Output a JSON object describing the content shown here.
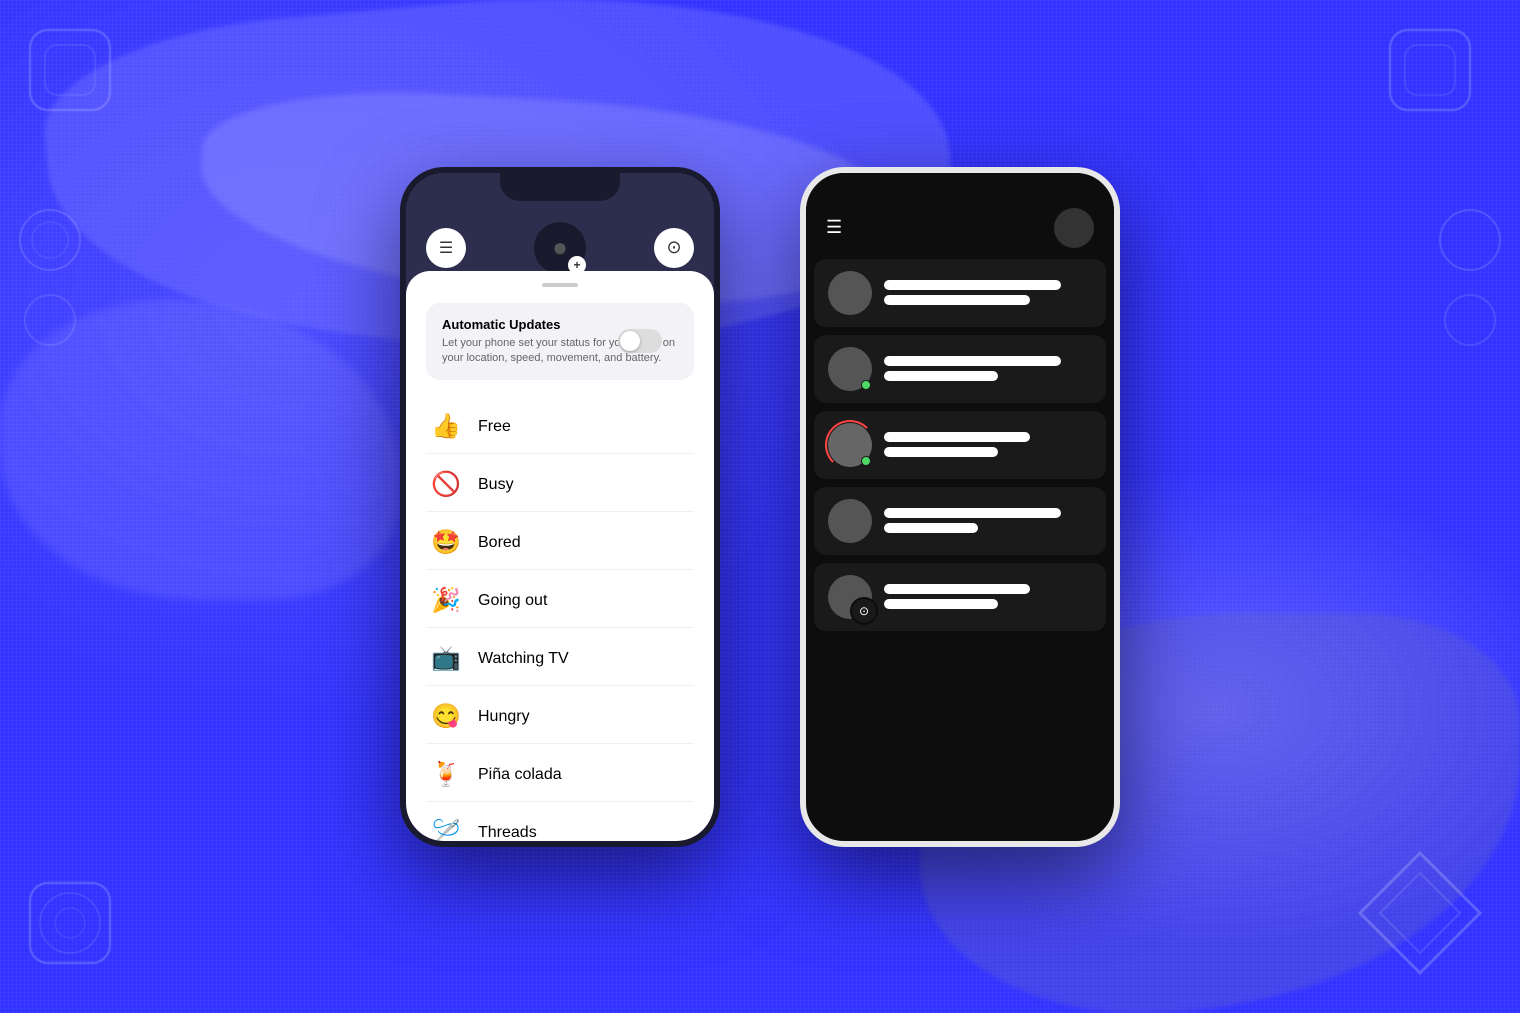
{
  "background": {
    "color": "#3333ff"
  },
  "phone_left": {
    "header": {
      "menu_icon": "☰",
      "camera_icon": "⊙"
    },
    "bottom_sheet": {
      "auto_updates": {
        "title": "Automatic Updates",
        "description": "Let your phone set your status for you based on your location, speed, movement, and battery.",
        "toggle_state": false
      },
      "status_items": [
        {
          "emoji": "👍",
          "label": "Free"
        },
        {
          "emoji": "🚫",
          "label": "Busy"
        },
        {
          "emoji": "🤩",
          "label": "Bored"
        },
        {
          "emoji": "🎉",
          "label": "Going out"
        },
        {
          "emoji": "📺",
          "label": "Watching TV"
        },
        {
          "emoji": "😋",
          "label": "Hungry"
        },
        {
          "emoji": "🍹",
          "label": "Piña colada"
        },
        {
          "emoji": "🪡",
          "label": "Threads"
        }
      ]
    }
  },
  "phone_right": {
    "contacts": [
      {
        "has_online": false,
        "has_ring": false,
        "has_camera": false,
        "lines": [
          "long",
          "medium"
        ]
      },
      {
        "has_online": true,
        "has_ring": false,
        "has_camera": false,
        "lines": [
          "long",
          "short"
        ]
      },
      {
        "has_online": true,
        "has_ring": true,
        "has_camera": false,
        "lines": [
          "medium",
          "short"
        ]
      },
      {
        "has_online": false,
        "has_ring": false,
        "has_camera": false,
        "lines": [
          "long",
          "xshort"
        ]
      },
      {
        "has_online": false,
        "has_ring": false,
        "has_camera": true,
        "lines": [
          "medium",
          "short"
        ]
      }
    ]
  }
}
